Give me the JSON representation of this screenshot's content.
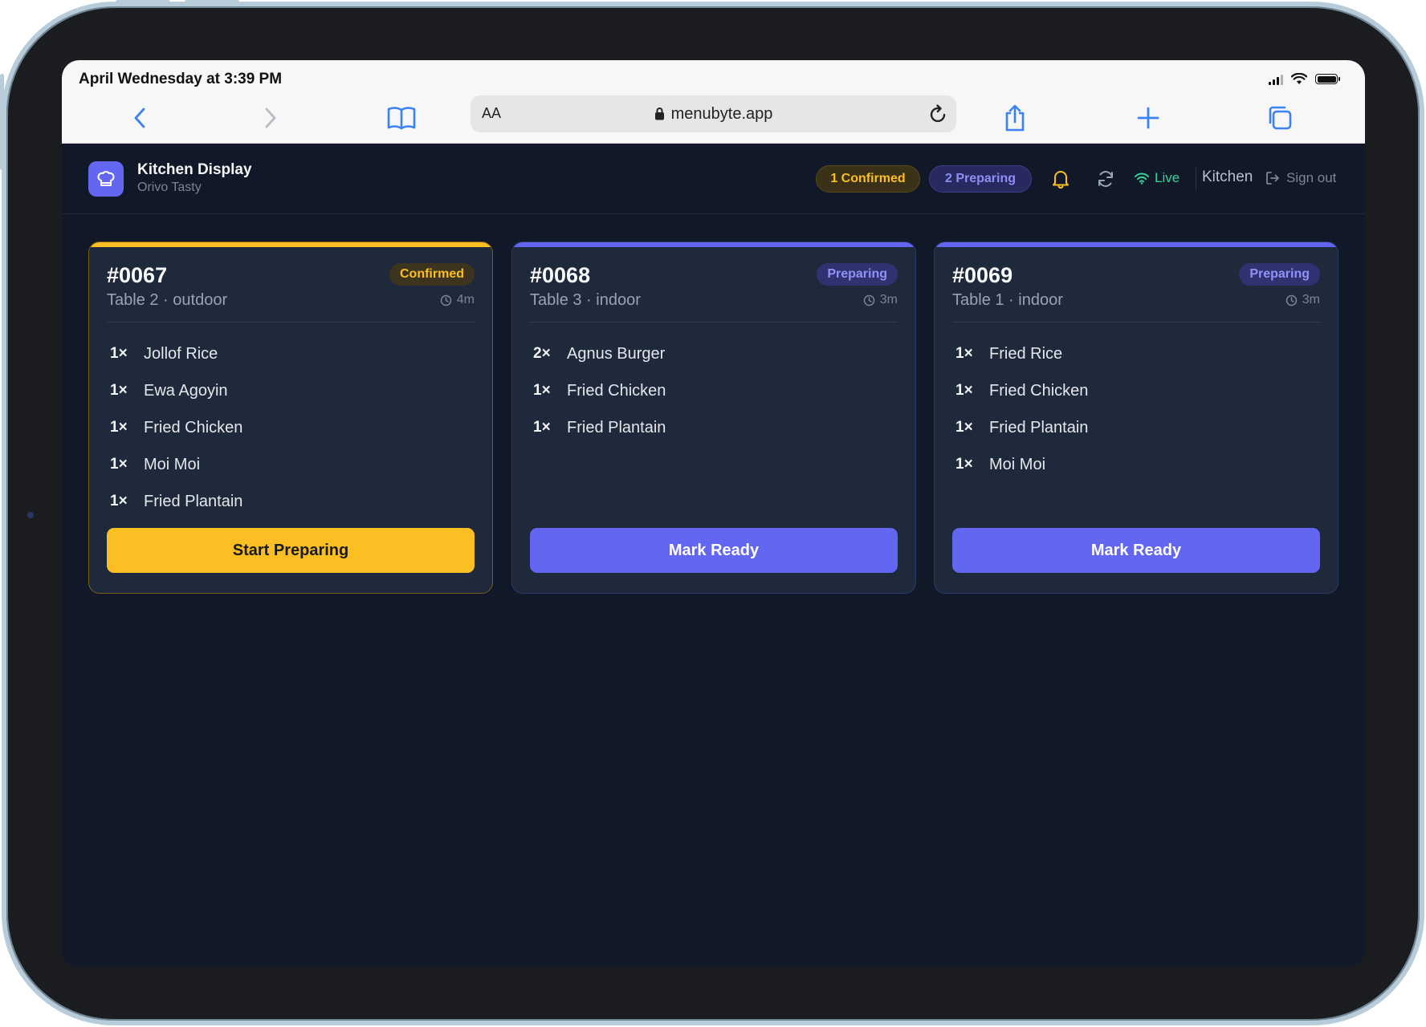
{
  "browser": {
    "status_time": "April Wednesday at 3:39 PM",
    "url_aa": "AA",
    "url": "menubyte.app"
  },
  "app": {
    "title": "Kitchen Display",
    "subtitle": "Orivo Tasty",
    "pill_confirmed": "1 Confirmed",
    "pill_preparing": "2 Preparing",
    "live_label": "Live",
    "station_label": "Kitchen",
    "signout_label": "Sign out"
  },
  "colors": {
    "confirmed": "#fbbf24",
    "preparing": "#6366f1",
    "live": "#34d399",
    "background": "#111827",
    "card": "#1e293b"
  },
  "orders": [
    {
      "number": "#0067",
      "status": "Confirmed",
      "table": "Table 2 · outdoor",
      "elapsed": "4m",
      "items": [
        {
          "qty": "1×",
          "name": "Jollof Rice"
        },
        {
          "qty": "1×",
          "name": "Ewa Agoyin"
        },
        {
          "qty": "1×",
          "name": "Fried Chicken"
        },
        {
          "qty": "1×",
          "name": "Moi Moi"
        },
        {
          "qty": "1×",
          "name": "Fried Plantain"
        }
      ],
      "action": "Start Preparing"
    },
    {
      "number": "#0068",
      "status": "Preparing",
      "table": "Table 3 · indoor",
      "elapsed": "3m",
      "items": [
        {
          "qty": "2×",
          "name": "Agnus Burger"
        },
        {
          "qty": "1×",
          "name": "Fried Chicken"
        },
        {
          "qty": "1×",
          "name": "Fried Plantain"
        }
      ],
      "action": "Mark Ready"
    },
    {
      "number": "#0069",
      "status": "Preparing",
      "table": "Table 1 · indoor",
      "elapsed": "3m",
      "items": [
        {
          "qty": "1×",
          "name": "Fried Rice"
        },
        {
          "qty": "1×",
          "name": "Fried Chicken"
        },
        {
          "qty": "1×",
          "name": "Fried Plantain"
        },
        {
          "qty": "1×",
          "name": "Moi Moi"
        }
      ],
      "action": "Mark Ready"
    }
  ]
}
